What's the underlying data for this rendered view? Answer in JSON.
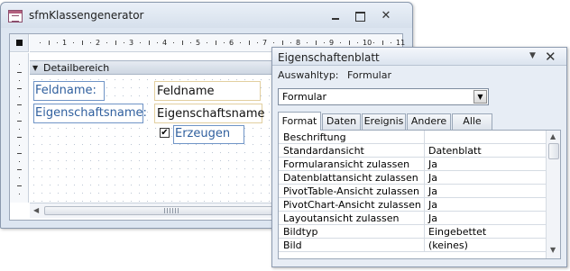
{
  "form": {
    "title": "sfmKlassengenerator",
    "section_label": "Detailbereich",
    "ruler_numbers": [
      "1",
      "2",
      "3",
      "4",
      "5",
      "6",
      "7",
      "8",
      "9",
      "10",
      "11"
    ],
    "controls": {
      "label_feldname": "Feldname:",
      "text_feldname": "Feldname",
      "label_eigenschaftsname": "Eigenschaftsname:",
      "text_eigenschaftsname": "Eigenschaftsname",
      "checkbox_checked": true,
      "label_erzeugen": "Erzeugen"
    }
  },
  "property_sheet": {
    "title": "Eigenschaftenblatt",
    "selection_type_label": "Auswahltyp:",
    "selection_type_value": "Formular",
    "selected_object": "Formular",
    "tabs": [
      "Format",
      "Daten",
      "Ereignis",
      "Andere",
      "Alle"
    ],
    "active_tab": "Format",
    "rows": [
      {
        "name": "Beschriftung",
        "value": ""
      },
      {
        "name": "Standardansicht",
        "value": "Datenblatt"
      },
      {
        "name": "Formularansicht zulassen",
        "value": "Ja"
      },
      {
        "name": "Datenblattansicht zulassen",
        "value": "Ja"
      },
      {
        "name": "PivotTable-Ansicht zulassen",
        "value": "Ja"
      },
      {
        "name": "PivotChart-Ansicht zulassen",
        "value": "Ja"
      },
      {
        "name": "Layoutansicht zulassen",
        "value": "Ja"
      },
      {
        "name": "Bildtyp",
        "value": "Eingebettet"
      },
      {
        "name": "Bild",
        "value": "(keines)"
      }
    ]
  },
  "icons": {
    "form_icon": "form-icon",
    "minimize": "minimize-icon",
    "maximize": "maximize-icon",
    "close": "close-icon",
    "section_collapse": "triangle-down-icon",
    "dropdown": "chevron-down-icon",
    "scroll_up": "scroll-up-icon",
    "scroll_down": "scroll-down-icon",
    "scroll_left": "scroll-left-icon",
    "scroll_right": "scroll-right-icon",
    "checkbox": "checkmark-icon"
  }
}
